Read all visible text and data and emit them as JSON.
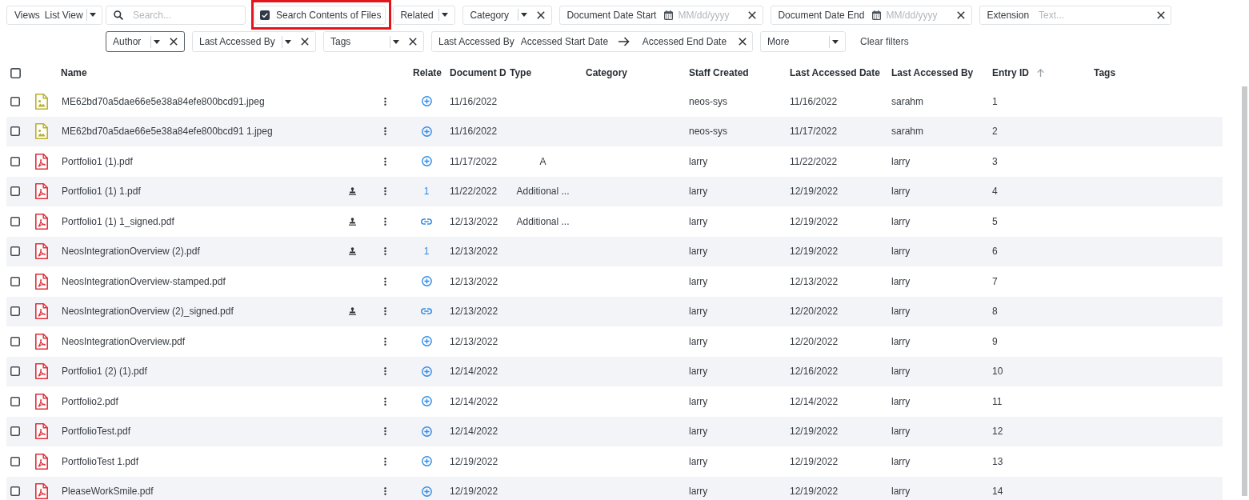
{
  "toolbar": {
    "views": {
      "label": "Views",
      "value": "List View"
    },
    "search": {
      "placeholder": "Search..."
    },
    "search_contents": {
      "label": "Search Contents of Files",
      "checked": true,
      "highlighted": true
    },
    "filters_row_1": [
      {
        "kind": "dropdown",
        "label": "Related",
        "clearable": false,
        "focused": false
      },
      {
        "kind": "dropdown",
        "label": "Category",
        "clearable": true,
        "focused": false
      },
      {
        "kind": "date",
        "label": "Document Date Start",
        "placeholder": "MM/dd/yyyy"
      },
      {
        "kind": "date",
        "label": "Document Date End",
        "placeholder": "MM/dd/yyyy"
      },
      {
        "kind": "text",
        "label": "Extension",
        "placeholder": "Text..."
      }
    ],
    "filters_row_2": [
      {
        "kind": "dropdown",
        "label": "Author",
        "clearable": true,
        "focused": true
      },
      {
        "kind": "dropdown",
        "label": "Last Accessed By",
        "clearable": true,
        "focused": false
      },
      {
        "kind": "dropdown",
        "label": "Tags",
        "clearable": true,
        "focused": false
      },
      {
        "kind": "range",
        "label": "Last Accessed By",
        "start": {
          "placeholder": "Accessed Start Date"
        },
        "end": {
          "placeholder": "Accessed End Date"
        }
      },
      {
        "kind": "dropdown",
        "label": "More",
        "clearable": false,
        "focused": false
      }
    ],
    "clear_filters": "Clear filters"
  },
  "table": {
    "select_all": {
      "checked": false
    },
    "columns": [
      {
        "label": "Name",
        "sorted": false
      },
      {
        "label": "Relate",
        "sorted": false
      },
      {
        "label": "Document D",
        "sorted": false
      },
      {
        "label": "Type",
        "sorted": false
      },
      {
        "label": "Category",
        "sorted": false
      },
      {
        "label": "Staff Created",
        "sorted": false
      },
      {
        "label": "Last Accessed Date",
        "sorted": false
      },
      {
        "label": "Last Accessed By",
        "sorted": false
      },
      {
        "label": "Entry ID",
        "sorted": true
      },
      {
        "label": "Tags",
        "sorted": false
      }
    ],
    "rows": [
      {
        "checked": false,
        "kind": "image",
        "name": "ME62bd70a5dae66e5e38a84efe800bcd91.jpeg",
        "stamped": false,
        "related": {
          "kind": "add"
        },
        "document_date": "11/16/2022",
        "staff_created": "neos-sys",
        "last_accessed_date": "11/16/2022",
        "last_accessed_by": "sarahm",
        "entry_id": "1"
      },
      {
        "checked": false,
        "kind": "image",
        "name": "ME62bd70a5dae66e5e38a84efe800bcd91 1.jpeg",
        "stamped": false,
        "related": {
          "kind": "add"
        },
        "document_date": "11/16/2022",
        "staff_created": "neos-sys",
        "last_accessed_date": "11/17/2022",
        "last_accessed_by": "sarahm",
        "entry_id": "2"
      },
      {
        "checked": false,
        "kind": "pdf",
        "name": "Portfolio1 (1).pdf",
        "stamped": false,
        "related": {
          "kind": "add"
        },
        "document_date": "11/17/2022",
        "type": "A",
        "staff_created": "larry",
        "last_accessed_date": "11/22/2022",
        "last_accessed_by": "larry",
        "entry_id": "3"
      },
      {
        "checked": false,
        "kind": "pdf",
        "name": "Portfolio1 (1) 1.pdf",
        "stamped": true,
        "related": {
          "kind": "count",
          "text": "1"
        },
        "document_date": "11/22/2022",
        "type": "Additional ...",
        "staff_created": "larry",
        "last_accessed_date": "12/19/2022",
        "last_accessed_by": "larry",
        "entry_id": "4"
      },
      {
        "checked": false,
        "kind": "pdf",
        "name": "Portfolio1 (1) 1_signed.pdf",
        "stamped": true,
        "related": {
          "kind": "link"
        },
        "document_date": "12/13/2022",
        "type": "Additional ...",
        "staff_created": "larry",
        "last_accessed_date": "12/19/2022",
        "last_accessed_by": "larry",
        "entry_id": "5"
      },
      {
        "checked": false,
        "kind": "pdf",
        "name": "NeosIntegrationOverview (2).pdf",
        "stamped": true,
        "related": {
          "kind": "count",
          "text": "1"
        },
        "document_date": "12/13/2022",
        "staff_created": "larry",
        "last_accessed_date": "12/19/2022",
        "last_accessed_by": "larry",
        "entry_id": "6"
      },
      {
        "checked": false,
        "kind": "pdf",
        "name": "NeosIntegrationOverview-stamped.pdf",
        "stamped": false,
        "related": {
          "kind": "add"
        },
        "document_date": "12/13/2022",
        "staff_created": "larry",
        "last_accessed_date": "12/13/2022",
        "last_accessed_by": "larry",
        "entry_id": "7"
      },
      {
        "checked": false,
        "kind": "pdf",
        "name": "NeosIntegrationOverview (2)_signed.pdf",
        "stamped": true,
        "related": {
          "kind": "link"
        },
        "document_date": "12/13/2022",
        "staff_created": "larry",
        "last_accessed_date": "12/20/2022",
        "last_accessed_by": "larry",
        "entry_id": "8"
      },
      {
        "checked": false,
        "kind": "pdf",
        "name": "NeosIntegrationOverview.pdf",
        "stamped": false,
        "related": {
          "kind": "add"
        },
        "document_date": "12/13/2022",
        "staff_created": "larry",
        "last_accessed_date": "12/20/2022",
        "last_accessed_by": "larry",
        "entry_id": "9"
      },
      {
        "checked": false,
        "kind": "pdf",
        "name": "Portfolio1 (2) (1).pdf",
        "stamped": false,
        "related": {
          "kind": "add"
        },
        "document_date": "12/14/2022",
        "staff_created": "larry",
        "last_accessed_date": "12/16/2022",
        "last_accessed_by": "larry",
        "entry_id": "10"
      },
      {
        "checked": false,
        "kind": "pdf",
        "name": "Portfolio2.pdf",
        "stamped": false,
        "related": {
          "kind": "add"
        },
        "document_date": "12/14/2022",
        "staff_created": "larry",
        "last_accessed_date": "12/14/2022",
        "last_accessed_by": "larry",
        "entry_id": "11"
      },
      {
        "checked": false,
        "kind": "pdf",
        "name": "PortfolioTest.pdf",
        "stamped": false,
        "related": {
          "kind": "add"
        },
        "document_date": "12/14/2022",
        "staff_created": "larry",
        "last_accessed_date": "12/19/2022",
        "last_accessed_by": "larry",
        "entry_id": "12"
      },
      {
        "checked": false,
        "kind": "pdf",
        "name": "PortfolioTest 1.pdf",
        "stamped": false,
        "related": {
          "kind": "add"
        },
        "document_date": "12/19/2022",
        "staff_created": "larry",
        "last_accessed_date": "12/19/2022",
        "last_accessed_by": "larry",
        "entry_id": "13"
      },
      {
        "checked": false,
        "kind": "pdf",
        "name": "PleaseWorkSmile.pdf",
        "stamped": false,
        "related": {
          "kind": "add"
        },
        "document_date": "12/19/2022",
        "staff_created": "larry",
        "last_accessed_date": "12/19/2022",
        "last_accessed_by": "larry",
        "entry_id": "14"
      }
    ]
  }
}
